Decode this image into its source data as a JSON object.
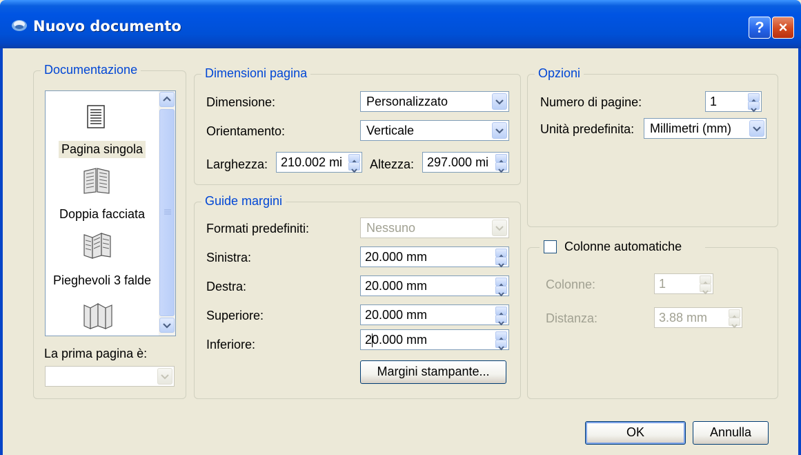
{
  "window": {
    "title": "Nuovo documento",
    "help_label": "?",
    "close_label": "×"
  },
  "documentazione": {
    "title": "Documentazione",
    "items": [
      {
        "label": "Pagina singola",
        "icon": "single-page-icon",
        "selected": true
      },
      {
        "label": "Doppia facciata",
        "icon": "double-sided-icon",
        "selected": false
      },
      {
        "label": "Pieghevoli 3 falde",
        "icon": "tri-fold-icon",
        "selected": false
      }
    ],
    "first_page_label": "La prima pagina è:",
    "first_page_value": ""
  },
  "dimensioni": {
    "title": "Dimensioni pagina",
    "size_label": "Dimensione:",
    "size_value": "Personalizzato",
    "orientation_label": "Orientamento:",
    "orientation_value": "Verticale",
    "width_label": "Larghezza:",
    "width_value": "210.002 mi",
    "height_label": "Altezza:",
    "height_value": "297.000 mi"
  },
  "margini": {
    "title": "Guide margini",
    "presets_label": "Formati predefiniti:",
    "presets_value": "Nessuno",
    "left_label": "Sinistra:",
    "left_value": "20.000 mm",
    "right_label": "Destra:",
    "right_value": "20.000 mm",
    "top_label": "Superiore:",
    "top_value": "20.000 mm",
    "bottom_label": "Inferiore:",
    "bottom_value": "20.000 mm",
    "printer_margins_label": "Margini stampante..."
  },
  "opzioni": {
    "title": "Opzioni",
    "pages_label": "Numero di pagine:",
    "pages_value": "1",
    "unit_label": "Unità predefinita:",
    "unit_value": "Millimetri (mm)"
  },
  "colonne": {
    "checkbox_label": "Colonne automatiche",
    "checked": false,
    "columns_label": "Colonne:",
    "columns_value": "1",
    "gap_label": "Distanza:",
    "gap_value": "3.88 mm"
  },
  "footer": {
    "ok_label": "OK",
    "cancel_label": "Annulla"
  }
}
